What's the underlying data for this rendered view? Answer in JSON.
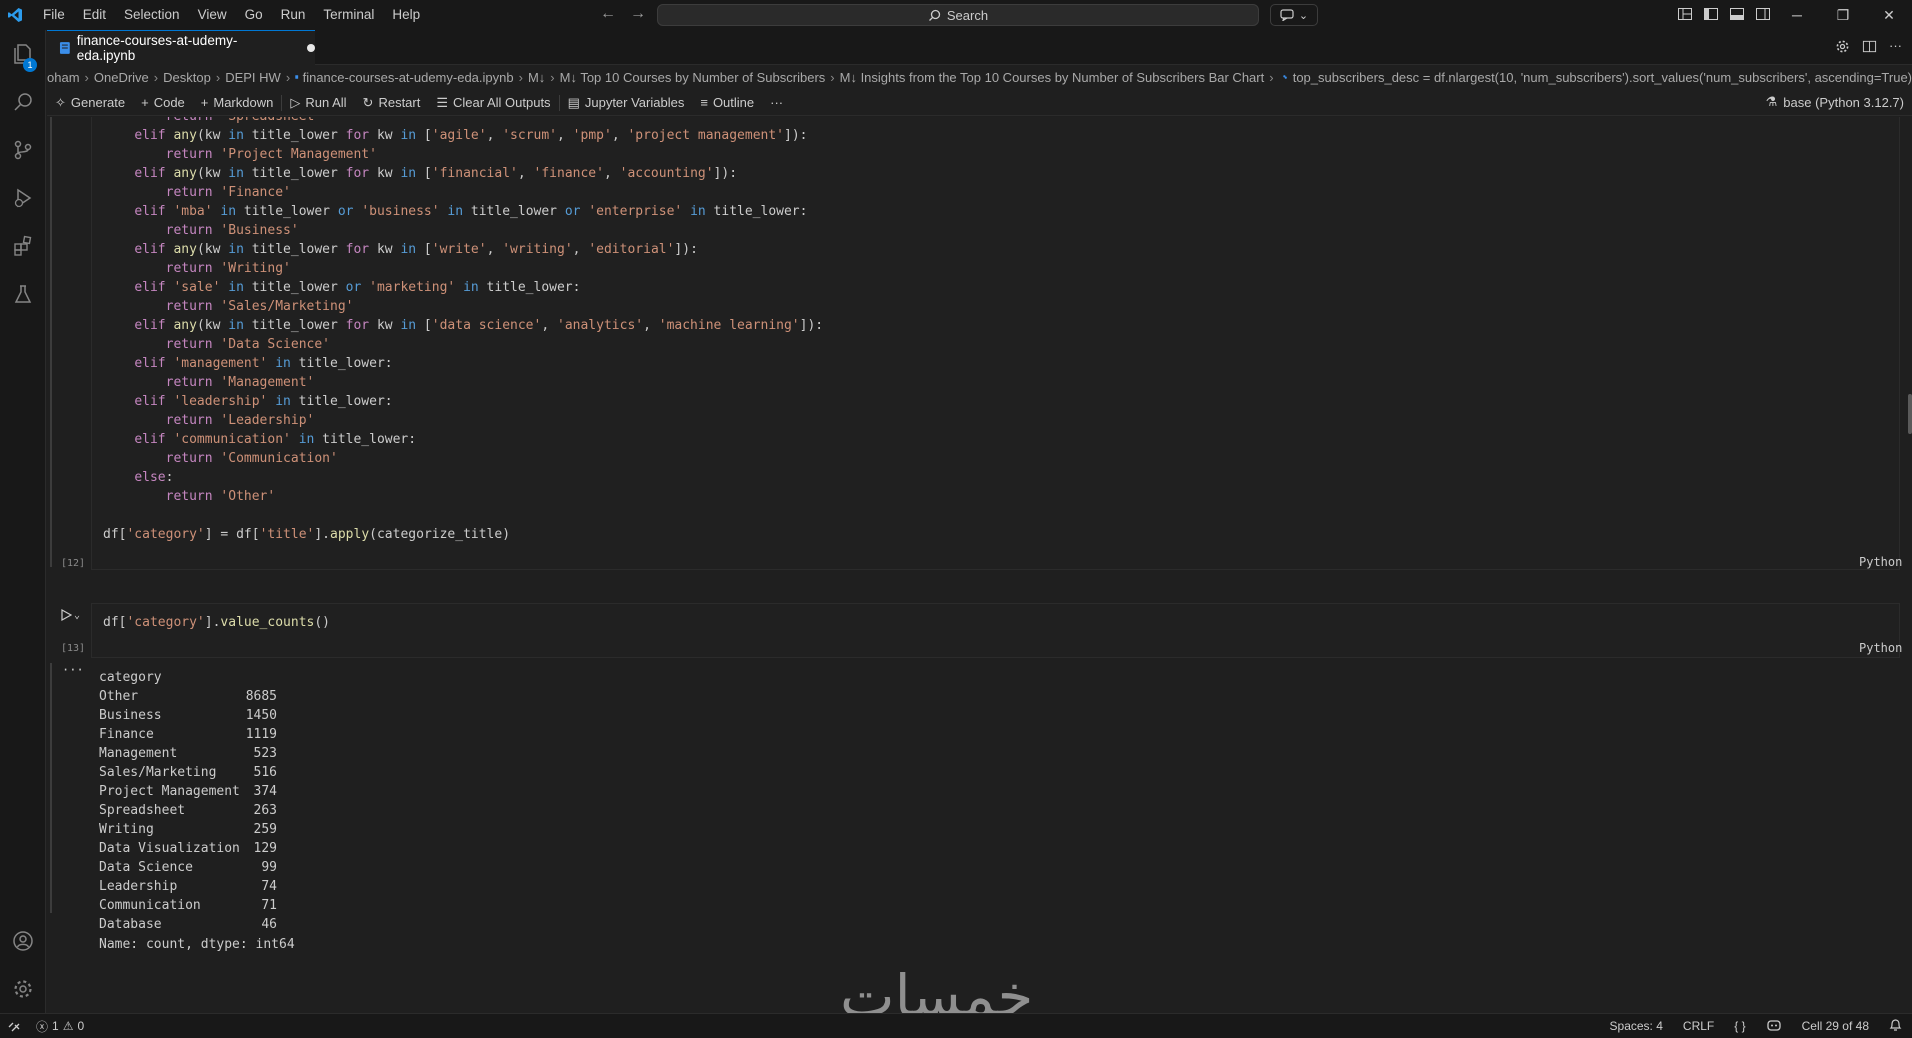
{
  "menu": [
    "File",
    "Edit",
    "Selection",
    "View",
    "Go",
    "Run",
    "Terminal",
    "Help"
  ],
  "search": {
    "label": "Search"
  },
  "activity": {
    "explorer_badge": "1"
  },
  "tab": {
    "filename": "finance-courses-at-udemy-eda.ipynb"
  },
  "breadcrumb": {
    "items": [
      "oham",
      "OneDrive",
      "Desktop",
      "DEPI HW",
      "finance-courses-at-udemy-eda.ipynb",
      "M↓",
      "M↓ Top 10 Courses by Number of Subscribers",
      "M↓ Insights from the Top 10 Courses by Number of Subscribers Bar Chart",
      "top_subscribers_desc = df.nlargest(10, 'num_subscribers').sort_values('num_subscribers', ascending=True)"
    ]
  },
  "toolbar": {
    "generate": "Generate",
    "code": "Code",
    "markdown": "Markdown",
    "run_all": "Run All",
    "restart": "Restart",
    "clear_outputs": "Clear All Outputs",
    "variables": "Jupyter Variables",
    "outline": "Outline",
    "more": "···",
    "kernel": "base (Python 3.12.7)"
  },
  "cell12": {
    "exec_count": "[12]",
    "language": "Python"
  },
  "cell13": {
    "exec_count": "[13]",
    "language": "Python",
    "code": "df['category'].value_counts()",
    "output_more": "···",
    "output_header": "category",
    "output_rows": [
      {
        "label": "Other",
        "count": "8685"
      },
      {
        "label": "Business",
        "count": "1450"
      },
      {
        "label": "Finance",
        "count": "1119"
      },
      {
        "label": "Management",
        "count": "523"
      },
      {
        "label": "Sales/Marketing",
        "count": "516"
      },
      {
        "label": "Project Management",
        "count": "374"
      },
      {
        "label": "Spreadsheet",
        "count": "263"
      },
      {
        "label": "Writing",
        "count": "259"
      },
      {
        "label": "Data Visualization",
        "count": "129"
      },
      {
        "label": "Data Science",
        "count": "99"
      },
      {
        "label": "Leadership",
        "count": "74"
      },
      {
        "label": "Communication",
        "count": "71"
      },
      {
        "label": "Database",
        "count": "46"
      }
    ],
    "output_footer": "Name: count, dtype: int64"
  },
  "watermark": "خمسات",
  "status": {
    "errors": "1",
    "warnings": "0",
    "spaces": "Spaces: 4",
    "eol": "CRLF",
    "braces": "{ }",
    "cell": "Cell 29 of 48"
  },
  "colors": {
    "accent": "#0078d4",
    "keyword": "#c586c0",
    "string": "#ce9178",
    "function": "#dcdcaa",
    "operator_kw": "#569cd6"
  }
}
